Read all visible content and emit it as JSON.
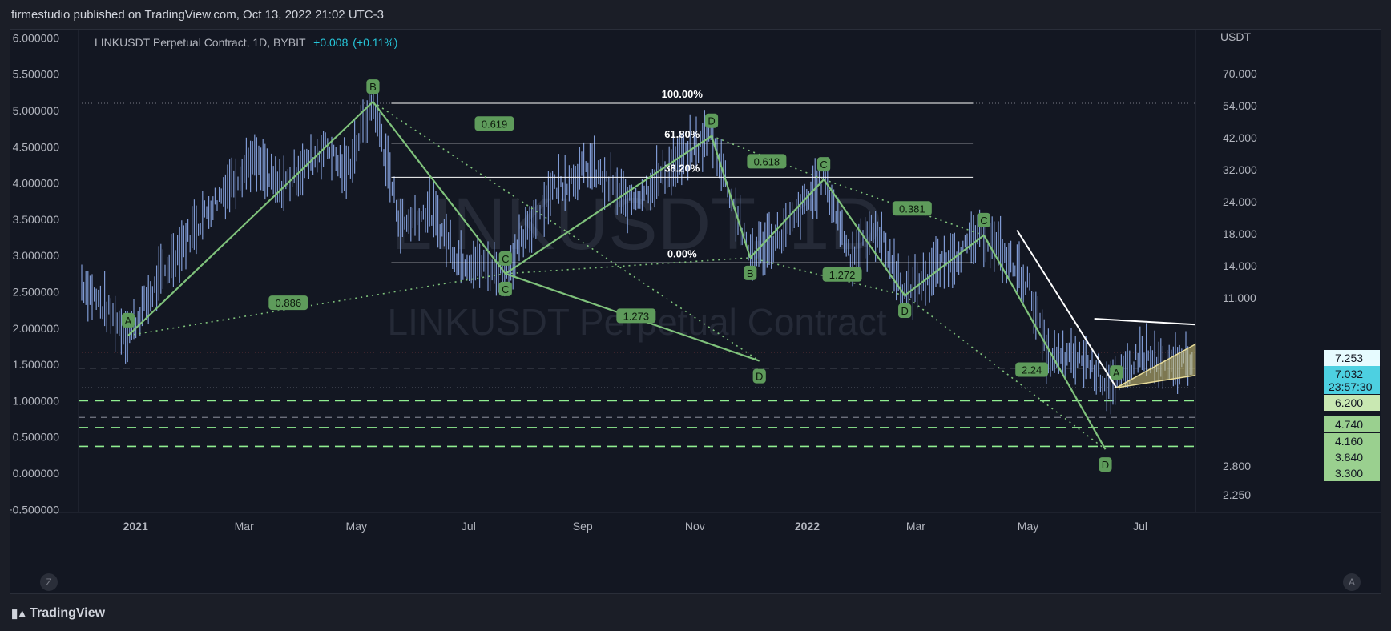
{
  "header": {
    "publisher": "firmestudio published on TradingView.com, Oct 13, 2022 21:02 UTC-3"
  },
  "symbol": {
    "name": "LINKUSDT Perpetual Contract, 1D, BYBIT",
    "change": "+0.008",
    "change_pct": "(+0.11%)"
  },
  "watermark": {
    "line1": "LINKUSDT, 1D",
    "line2": "LINKUSDT Perpetual Contract"
  },
  "footer": {
    "brand": "TradingView",
    "logo_icon": "tradingview-logo-icon",
    "left_button": "Z",
    "right_button": "A"
  },
  "colors": {
    "background": "#131722",
    "candle": "#7f9ad3",
    "pattern": "#7fc27b",
    "label_bg": "#5e9b5b",
    "fib": "#ffffff",
    "price_tag": "#9ad08f",
    "last_price": "#4dd0e1"
  },
  "chart_data": {
    "type": "candlestick",
    "x_ticks": [
      "2021",
      "Mar",
      "May",
      "Jul",
      "Sep",
      "Nov",
      "2022",
      "Mar",
      "May",
      "Jul"
    ],
    "left_axis": {
      "ticks": [
        "6.000000",
        "5.500000",
        "5.000000",
        "4.500000",
        "4.000000",
        "3.500000",
        "3.000000",
        "2.500000",
        "2.000000",
        "1.500000",
        "1.000000",
        "0.500000",
        "0.000000",
        "−0.500000"
      ],
      "range": [
        -0.5,
        6.0
      ]
    },
    "right_axis": {
      "unit": "USDT",
      "ticks": [
        "70.000",
        "54.000",
        "42.000",
        "32.000",
        "24.000",
        "18.000",
        "14.000",
        "11.000",
        "2.800",
        "2.250"
      ],
      "tags": [
        {
          "value": "7.253",
          "kind": "high"
        },
        {
          "value": "7.032",
          "kind": "last"
        },
        {
          "value": "23:57:30",
          "kind": "countdown"
        },
        {
          "value": "6.200",
          "kind": "level"
        },
        {
          "value": "4.740",
          "kind": "level"
        },
        {
          "value": "4.160",
          "kind": "level"
        },
        {
          "value": "3.840",
          "kind": "level"
        },
        {
          "value": "3.300",
          "kind": "level"
        }
      ]
    },
    "fib_levels": [
      {
        "label": "100.00%",
        "price": 5.1
      },
      {
        "label": "61.80%",
        "price": 4.55
      },
      {
        "label": "38.20%",
        "price": 4.08
      },
      {
        "label": "0.00%",
        "price": 2.9
      }
    ],
    "horizontal_levels": [
      {
        "price": 1.0,
        "style": "green-dashed"
      },
      {
        "price": 0.77,
        "style": "gray-dashed"
      },
      {
        "price": 0.63,
        "style": "green-dashed"
      },
      {
        "price": 0.37,
        "style": "green-dashed"
      },
      {
        "price": 1.45,
        "style": "gray-dashed"
      },
      {
        "price": 1.67,
        "style": "red-dotted"
      },
      {
        "price": 5.1,
        "style": "gray-dotted"
      },
      {
        "price": 1.18,
        "style": "gray-dotted"
      }
    ],
    "patterns": [
      {
        "points": [
          {
            "label": "A",
            "time": "2020-12-28",
            "price": 1.9
          },
          {
            "label": "B",
            "time": "2021-05-10",
            "price": 5.12
          },
          {
            "label": "C",
            "time": "2021-07-21",
            "price": 2.75
          },
          {
            "label": "D",
            "time": "2021-12-06",
            "price": 1.55
          }
        ],
        "ratios": [
          {
            "value": "0.886",
            "time": "2021-03-25",
            "price": 2.35
          },
          {
            "value": "1.273",
            "time": "2021-09-30",
            "price": 2.17
          }
        ]
      },
      {
        "points": [
          {
            "label": "C",
            "time": "2021-07-21",
            "price": 2.75
          },
          {
            "label": "D",
            "time": "2021-11-10",
            "price": 4.65
          },
          {
            "label": "B",
            "time": "2021-12-01",
            "price": 2.97
          },
          {
            "label": "C",
            "time": "2022-01-10",
            "price": 4.05
          },
          {
            "label": "D",
            "time": "2022-02-23",
            "price": 2.45
          },
          {
            "label": "C",
            "time": "2022-04-07",
            "price": 3.28
          },
          {
            "label": "D",
            "time": "2022-06-12",
            "price": 0.33
          }
        ],
        "ratios": [
          {
            "value": "0.619",
            "time": "2021-07-15",
            "price": 4.82
          },
          {
            "value": "0.618",
            "time": "2021-12-10",
            "price": 4.3
          },
          {
            "value": "0.381",
            "time": "2022-02-27",
            "price": 3.65
          },
          {
            "value": "1.272",
            "time": "2022-01-20",
            "price": 2.74
          },
          {
            "value": "2.24",
            "time": "2022-05-03",
            "price": 1.43
          }
        ]
      },
      {
        "points": [
          {
            "label": "A",
            "time": "2022-06-18",
            "price": 1.18
          }
        ],
        "ratios": []
      }
    ],
    "price_path": [
      [
        "2020-12-01",
        2.65
      ],
      [
        "2020-12-28",
        1.9
      ],
      [
        "2021-01-20",
        2.9
      ],
      [
        "2021-02-12",
        3.7
      ],
      [
        "2021-03-05",
        4.3
      ],
      [
        "2021-03-20",
        3.9
      ],
      [
        "2021-04-15",
        4.5
      ],
      [
        "2021-04-25",
        4.1
      ],
      [
        "2021-05-10",
        5.12
      ],
      [
        "2021-05-25",
        3.4
      ],
      [
        "2021-06-10",
        3.6
      ],
      [
        "2021-06-25",
        2.95
      ],
      [
        "2021-07-21",
        2.75
      ],
      [
        "2021-08-15",
        3.9
      ],
      [
        "2021-09-05",
        4.2
      ],
      [
        "2021-09-25",
        3.7
      ],
      [
        "2021-10-15",
        4.1
      ],
      [
        "2021-11-10",
        4.65
      ],
      [
        "2021-12-01",
        2.97
      ],
      [
        "2021-12-20",
        3.3
      ],
      [
        "2022-01-10",
        4.05
      ],
      [
        "2022-01-25",
        2.95
      ],
      [
        "2022-02-08",
        3.35
      ],
      [
        "2022-02-23",
        2.45
      ],
      [
        "2022-03-15",
        2.85
      ],
      [
        "2022-04-07",
        3.28
      ],
      [
        "2022-05-01",
        2.6
      ],
      [
        "2022-05-12",
        1.55
      ],
      [
        "2022-06-01",
        1.55
      ],
      [
        "2022-06-12",
        1.25
      ],
      [
        "2022-06-18",
        1.18
      ],
      [
        "2022-07-01",
        1.65
      ],
      [
        "2022-07-15",
        1.4
      ],
      [
        "2022-07-31",
        1.62
      ]
    ]
  }
}
